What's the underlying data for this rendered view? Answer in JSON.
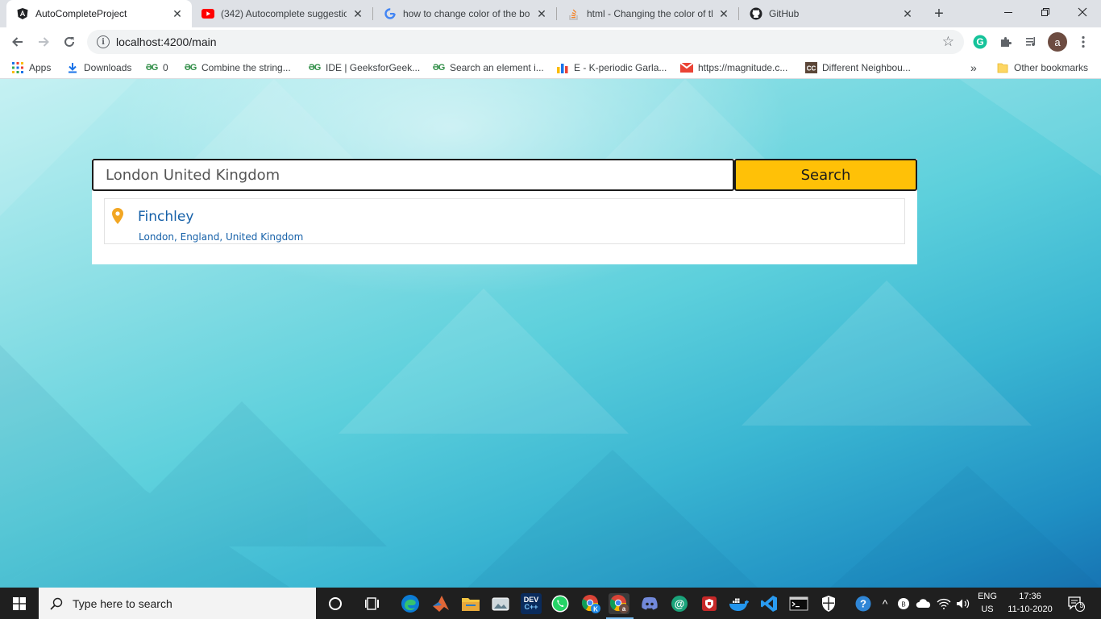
{
  "browser": {
    "tabs": [
      {
        "title": "AutoCompleteProject",
        "icon": "angular-icon",
        "active": true
      },
      {
        "title": "(342) Autocomplete suggestion",
        "icon": "youtube-icon",
        "active": false
      },
      {
        "title": "how to change color of the bo",
        "icon": "google-icon",
        "active": false
      },
      {
        "title": "html - Changing the color of th",
        "icon": "stackoverflow-icon",
        "active": false
      },
      {
        "title": "GitHub",
        "icon": "github-icon",
        "active": false
      }
    ],
    "new_tab": "+",
    "url": "localhost:4200/main",
    "profile_initial": "a",
    "bookmarks": [
      {
        "label": "Apps",
        "icon": "apps-grid-icon"
      },
      {
        "label": "Downloads",
        "icon": "download-icon"
      },
      {
        "label": "0",
        "icon": "geeksforgeeks-icon"
      },
      {
        "label": "Combine the string...",
        "icon": "geeksforgeeks-icon"
      },
      {
        "label": "IDE | GeeksforGeek...",
        "icon": "geeksforgeeks-icon"
      },
      {
        "label": "Search an element i...",
        "icon": "geeksforgeeks-icon"
      },
      {
        "label": "E - K-periodic Garla...",
        "icon": "codeforces-icon"
      },
      {
        "label": "https://magnitude.c...",
        "icon": "gmail-icon"
      },
      {
        "label": "Different Neighbou...",
        "icon": "codechef-icon"
      }
    ],
    "bookmarks_overflow": "»",
    "other_bookmarks": "Other bookmarks"
  },
  "page": {
    "search_value": "London United Kingdom",
    "search_button": "Search",
    "suggestion": {
      "title": "Finchley",
      "subtitle": "London, England, United Kingdom"
    },
    "colors": {
      "button": "#ffc107",
      "link": "#1560a8",
      "pin": "#f2a623"
    }
  },
  "taskbar": {
    "search_placeholder": "Type here to search",
    "language": "ENG",
    "region": "US",
    "time": "17:36",
    "date": "11-10-2020",
    "notification_count": "5"
  }
}
